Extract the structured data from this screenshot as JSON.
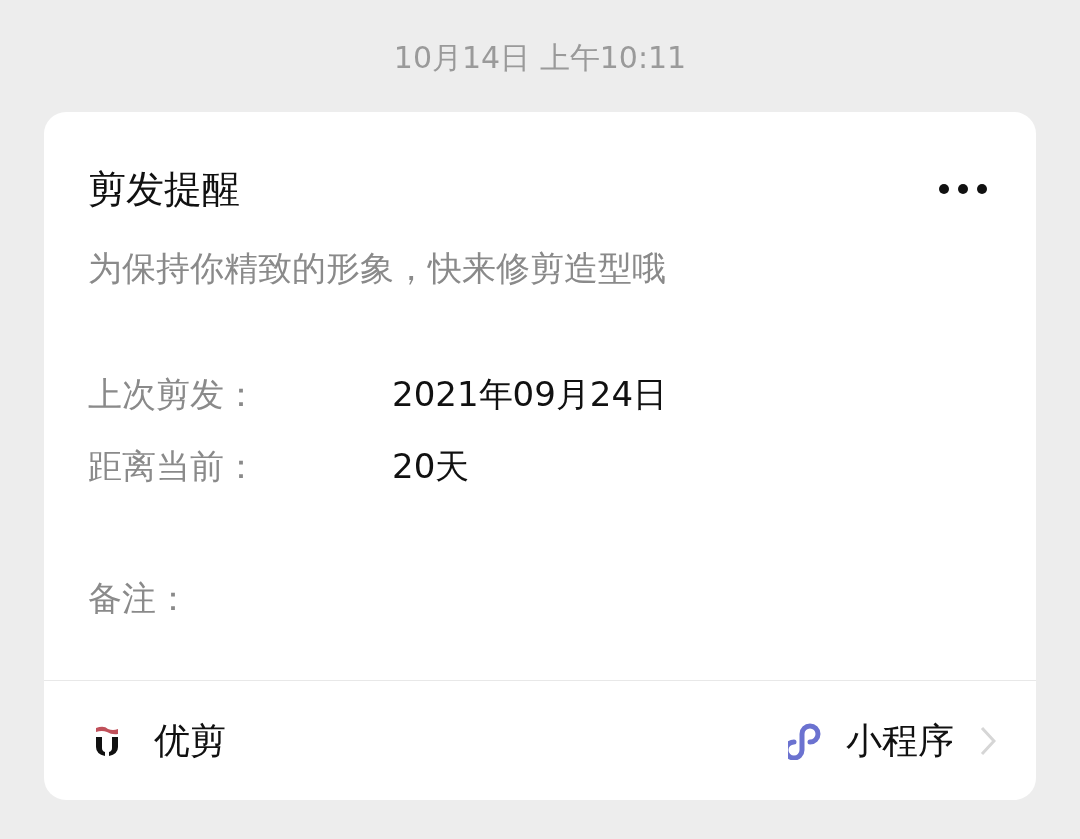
{
  "timestamp": "10月14日 上午10:11",
  "card": {
    "title": "剪发提醒",
    "subtitle": "为保持你精致的形象，快来修剪造型哦",
    "fields": [
      {
        "label": "上次剪发：",
        "value": "2021年09月24日"
      },
      {
        "label": "距离当前：",
        "value": "20天"
      }
    ],
    "note": {
      "label": "备注："
    },
    "footer": {
      "app_name": "优剪",
      "type_label": "小程序"
    }
  }
}
